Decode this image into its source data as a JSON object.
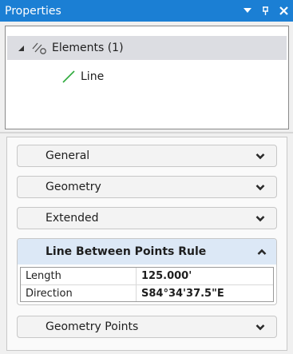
{
  "titlebar": {
    "title": "Properties",
    "dropdown_icon": "triangle-down-icon",
    "pin_icon": "pin-icon",
    "close_icon": "close-icon"
  },
  "tree": {
    "root": {
      "label": "Elements (1)",
      "expanded": true,
      "icon": "elements-icon"
    },
    "children": [
      {
        "label": "Line",
        "icon": "line-icon"
      }
    ]
  },
  "groups": [
    {
      "label": "General",
      "expanded": false
    },
    {
      "label": "Geometry",
      "expanded": false
    },
    {
      "label": "Extended",
      "expanded": false
    },
    {
      "label": "Line Between Points Rule",
      "expanded": true
    },
    {
      "label": "Geometry Points",
      "expanded": false
    }
  ],
  "line_between_points_rule": {
    "properties": [
      {
        "name": "Length",
        "value": "125.000'"
      },
      {
        "name": "Direction",
        "value": "S84°34'37.5\"E"
      }
    ]
  },
  "colors": {
    "titlebar": "#1b7fd4",
    "expanded_header": "#dce8f6",
    "line_icon": "#2eaa3c"
  }
}
